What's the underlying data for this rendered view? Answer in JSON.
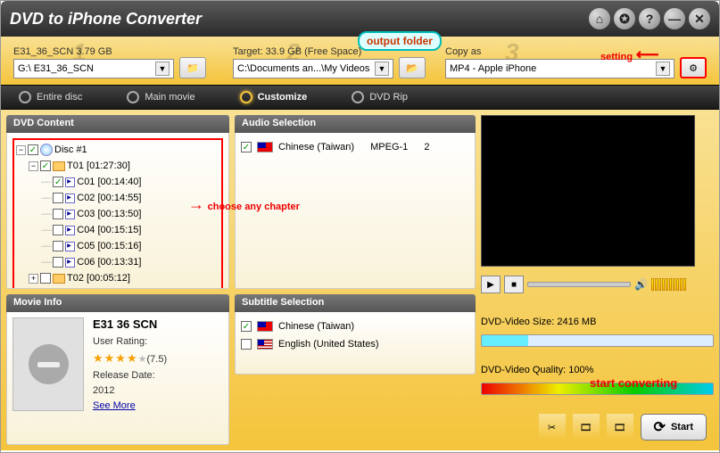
{
  "title": "DVD to iPhone Converter",
  "source": {
    "label": "E31_36_SCN 3.79 GB",
    "value": "G:\\ E31_36_SCN"
  },
  "target": {
    "label": "Target: 33.9 GB (Free Space)",
    "value": "C:\\Documents an...\\My Videos"
  },
  "copyas": {
    "label": "Copy as",
    "value": "MP4 - Apple iPhone"
  },
  "annot": {
    "output_folder": "output folder",
    "setting": "setting",
    "choose": "choose any chapter",
    "start": "start converting"
  },
  "tabs": [
    "Entire disc",
    "Main movie",
    "Customize",
    "DVD Rip"
  ],
  "active_tab": 2,
  "dvd_content": {
    "header": "DVD Content",
    "disc": "Disc #1",
    "titles": [
      {
        "name": "T01 [01:27:30]",
        "checked": true,
        "expanded": true,
        "chapters": [
          {
            "name": "C01 [00:14:40]",
            "checked": true
          },
          {
            "name": "C02 [00:14:55]",
            "checked": false
          },
          {
            "name": "C03 [00:13:50]",
            "checked": false
          },
          {
            "name": "C04 [00:15:15]",
            "checked": false
          },
          {
            "name": "C05 [00:15:16]",
            "checked": false
          },
          {
            "name": "C06 [00:13:31]",
            "checked": false
          }
        ]
      },
      {
        "name": "T02 [00:05:12]",
        "checked": false,
        "expanded": false,
        "chapters": []
      }
    ]
  },
  "movie_info": {
    "header": "Movie Info",
    "title": "E31 36 SCN",
    "rating_label": "User Rating:",
    "rating": "(7.5)",
    "release_label": "Release Date:",
    "release": "2012",
    "see_more": "See More"
  },
  "audio": {
    "header": "Audio Selection",
    "items": [
      {
        "lang": "Chinese (Taiwan)",
        "codec": "MPEG-1",
        "ch": "2",
        "flag": "tw",
        "checked": true
      }
    ]
  },
  "subtitle": {
    "header": "Subtitle Selection",
    "items": [
      {
        "lang": "Chinese (Taiwan)",
        "flag": "tw",
        "checked": true
      },
      {
        "lang": "English (United States)",
        "flag": "us",
        "checked": false
      }
    ]
  },
  "preview": {
    "size_label": "DVD-Video Size: 2416 MB",
    "quality_label": "DVD-Video Quality: 100%"
  },
  "start": "Start"
}
